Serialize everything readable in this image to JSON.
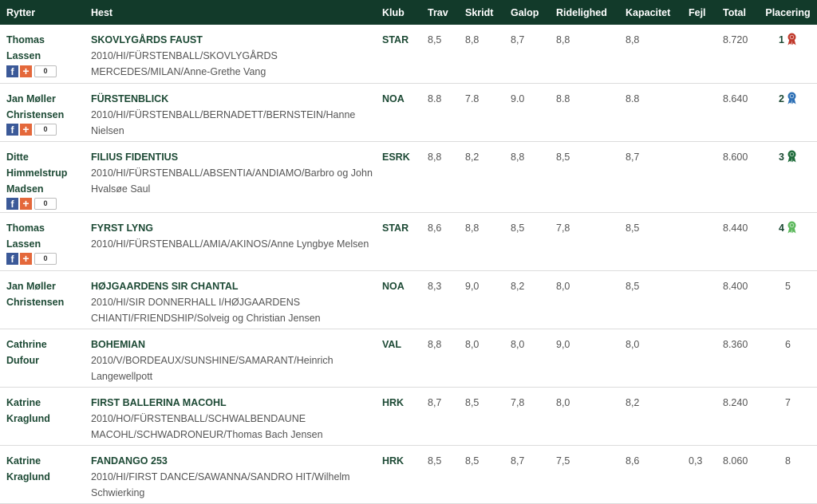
{
  "columns": {
    "rytter": "Rytter",
    "hest": "Hest",
    "klub": "Klub",
    "trav": "Trav",
    "skridt": "Skridt",
    "galop": "Galop",
    "ridelighed": "Ridelighed",
    "kapacitet": "Kapacitet",
    "fejl": "Fejl",
    "total": "Total",
    "placering": "Placering"
  },
  "colors": {
    "header_bg": "#123a2a",
    "accent_text": "#1d4a35",
    "rosette_1": "#c0392b",
    "rosette_2": "#2c6fb5",
    "rosette_3": "#1e6b3a",
    "rosette_4": "#5cb85c"
  },
  "rows": [
    {
      "rytter_lines": [
        "Thomas",
        "Lassen"
      ],
      "hest_name": "SKOVLYGÅRDS FAUST",
      "hest_desc": "2010/HI/FÜRSTENBALL/SKOVLYGÅRDS MERCEDES/MILAN/Anne-Grethe Vang",
      "klub": "STAR",
      "trav": "8,5",
      "skridt": "8,8",
      "galop": "8,7",
      "ridelighed": "8,8",
      "kapacitet": "8,8",
      "fejl": "",
      "total": "8.720",
      "placering": "1",
      "social": {
        "fb": "f",
        "plus": "+",
        "count": "0"
      },
      "rosette": "rosette-1"
    },
    {
      "rytter_lines": [
        "Jan Møller",
        "Christensen"
      ],
      "hest_name": "FÜRSTENBLICK",
      "hest_desc": "2010/HI/FÜRSTENBALL/BERNADETT/BERNSTEIN/Hanne Nielsen",
      "klub": "NOA",
      "trav": "8.8",
      "skridt": "7.8",
      "galop": "9.0",
      "ridelighed": "8.8",
      "kapacitet": "8.8",
      "fejl": "",
      "total": "8.640",
      "placering": "2",
      "social": {
        "fb": "f",
        "plus": "+",
        "count": "0"
      },
      "rosette": "rosette-2"
    },
    {
      "rytter_lines": [
        "Ditte",
        "Himmelstrup",
        "Madsen"
      ],
      "hest_name": "FILIUS FIDENTIUS",
      "hest_desc": "2010/HI/FÜRSTENBALL/ABSENTIA/ANDIAMO/Barbro og John Hvalsøe Saul",
      "klub": "ESRK",
      "trav": "8,8",
      "skridt": "8,2",
      "galop": "8,8",
      "ridelighed": "8,5",
      "kapacitet": "8,7",
      "fejl": "",
      "total": "8.600",
      "placering": "3",
      "social": {
        "fb": "f",
        "plus": "+",
        "count": "0"
      },
      "rosette": "rosette-3"
    },
    {
      "rytter_lines": [
        "Thomas",
        "Lassen"
      ],
      "hest_name": "FYRST LYNG",
      "hest_desc": "2010/HI/FÜRSTENBALL/AMIA/AKINOS/Anne Lyngbye Melsen",
      "klub": "STAR",
      "trav": "8,6",
      "skridt": "8,8",
      "galop": "8,5",
      "ridelighed": "7,8",
      "kapacitet": "8,5",
      "fejl": "",
      "total": "8.440",
      "placering": "4",
      "social": {
        "fb": "f",
        "plus": "+",
        "count": "0"
      },
      "rosette": "rosette-4"
    },
    {
      "rytter_lines": [
        "Jan Møller",
        "Christensen"
      ],
      "hest_name": "HØJGAARDENS SIR CHANTAL",
      "hest_desc": "2010/HI/SIR DONNERHALL I/HØJGAARDENS CHIANTI/FRIENDSHIP/Solveig og Christian Jensen",
      "klub": "NOA",
      "trav": "8,3",
      "skridt": "9,0",
      "galop": "8,2",
      "ridelighed": "8,0",
      "kapacitet": "8,5",
      "fejl": "",
      "total": "8.400",
      "placering": "5",
      "social": null,
      "rosette": null
    },
    {
      "rytter_lines": [
        "Cathrine",
        "Dufour"
      ],
      "hest_name": "BOHEMIAN",
      "hest_desc": "2010/V/BORDEAUX/SUNSHINE/SAMARANT/Heinrich Langewellpott",
      "klub": "VAL",
      "trav": "8,8",
      "skridt": "8,0",
      "galop": "8,0",
      "ridelighed": "9,0",
      "kapacitet": "8,0",
      "fejl": "",
      "total": "8.360",
      "placering": "6",
      "social": null,
      "rosette": null
    },
    {
      "rytter_lines": [
        "Katrine",
        "Kraglund"
      ],
      "hest_name": "FIRST BALLERINA MACOHL",
      "hest_desc": "2010/HO/FÜRSTENBALL/SCHWALBENDAUNE MACOHL/SCHWADRONEUR/Thomas Bach Jensen",
      "klub": "HRK",
      "trav": "8,7",
      "skridt": "8,5",
      "galop": "7,8",
      "ridelighed": "8,0",
      "kapacitet": "8,2",
      "fejl": "",
      "total": "8.240",
      "placering": "7",
      "social": null,
      "rosette": null
    },
    {
      "rytter_lines": [
        "Katrine",
        "Kraglund"
      ],
      "hest_name": "FANDANGO 253",
      "hest_desc": "2010/HI/FIRST DANCE/SAWANNA/SANDRO HIT/Wilhelm Schwierking",
      "klub": "HRK",
      "trav": "8,5",
      "skridt": "8,5",
      "galop": "8,7",
      "ridelighed": "7,5",
      "kapacitet": "8,6",
      "fejl": "0,3",
      "total": "8.060",
      "placering": "8",
      "social": null,
      "rosette": null
    }
  ]
}
